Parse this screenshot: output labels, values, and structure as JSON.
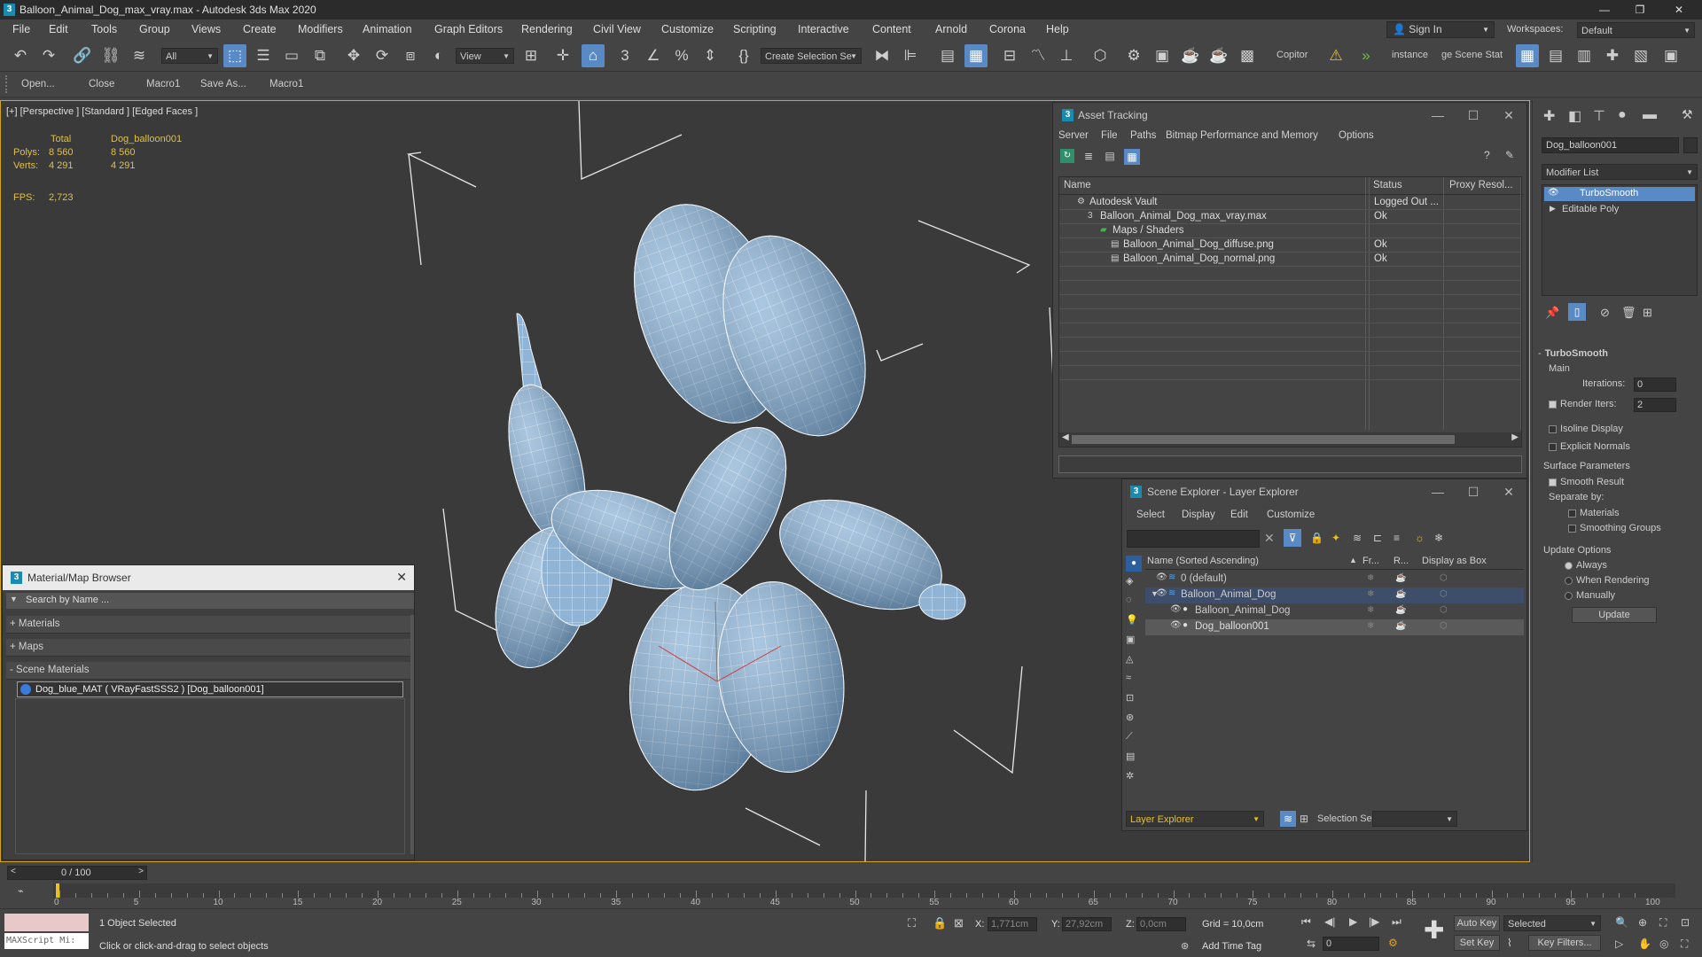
{
  "window": {
    "title": "Balloon_Animal_Dog_max_vray.max - Autodesk 3ds Max 2020"
  },
  "menu": [
    "File",
    "Edit",
    "Tools",
    "Group",
    "Views",
    "Create",
    "Modifiers",
    "Animation",
    "Graph Editors",
    "Rendering",
    "Civil View",
    "Customize",
    "Scripting",
    "Interactive",
    "Content",
    "Arnold",
    "Corona",
    "Help"
  ],
  "account": {
    "sign_in": "Sign In",
    "workspaces_label": "Workspaces:",
    "workspace": "Default"
  },
  "toolbar": {
    "selection_filter": "All",
    "ref_coord": "View",
    "named_selection": "Create Selection Se",
    "copitor": "Copitor",
    "instance": "instance",
    "scene_state": "ge Scene Stat"
  },
  "macros": [
    "Open...",
    "Close",
    "Macro1",
    "Save As...",
    "Macro1"
  ],
  "viewport": {
    "label": "[+] [Perspective ] [Standard ] [Edged Faces ]",
    "stats": {
      "total_label": "Total",
      "object_label": "Dog_balloon001",
      "polys_label": "Polys:",
      "polys_total": "8 560",
      "polys_obj": "8 560",
      "verts_label": "Verts:",
      "verts_total": "4 291",
      "verts_obj": "4 291",
      "fps_label": "FPS:",
      "fps_value": "2,723"
    }
  },
  "material_browser": {
    "title": "Material/Map Browser",
    "search_placeholder": "Search by Name ...",
    "sections": [
      "+ Materials",
      "+ Maps",
      "- Scene Materials"
    ],
    "scene_material": "Dog_blue_MAT ( VRayFastSSS2 ) [Dog_balloon001]"
  },
  "asset_tracking": {
    "title": "Asset Tracking",
    "menu": [
      "Server",
      "File",
      "Paths",
      "Bitmap Performance and Memory",
      "Options"
    ],
    "columns": [
      "Name",
      "Status",
      "Proxy Resol..."
    ],
    "rows": [
      {
        "name": "Autodesk Vault",
        "status": "Logged Out ..."
      },
      {
        "name": "Balloon_Animal_Dog_max_vray.max",
        "status": "Ok"
      },
      {
        "name": "Maps / Shaders",
        "status": ""
      },
      {
        "name": "Balloon_Animal_Dog_diffuse.png",
        "status": "Ok"
      },
      {
        "name": "Balloon_Animal_Dog_normal.png",
        "status": "Ok"
      }
    ]
  },
  "scene_explorer": {
    "title": "Scene Explorer - Layer Explorer",
    "menu": [
      "Select",
      "Display",
      "Edit",
      "Customize"
    ],
    "columns": [
      "Name (Sorted Ascending)",
      "Fr...",
      "R...",
      "Display as Box"
    ],
    "rows": [
      "0 (default)",
      "Balloon_Animal_Dog",
      "Balloon_Animal_Dog",
      "Dog_balloon001"
    ],
    "footer_label": "Layer Explorer",
    "selection_set_label": "Selection Set:"
  },
  "command_panel": {
    "object_name": "Dog_balloon001",
    "modifier_list": "Modifier List",
    "stack": [
      "TurboSmooth",
      "Editable Poly"
    ],
    "turbosmooth": {
      "title": "TurboSmooth",
      "main": "Main",
      "iterations_label": "Iterations:",
      "iterations": "0",
      "render_iters_label": "Render Iters:",
      "render_iters": "2",
      "isoline": "Isoline Display",
      "explicit_normals": "Explicit Normals",
      "surface_params": "Surface Parameters",
      "smooth_result": "Smooth Result",
      "separate_by": "Separate by:",
      "materials": "Materials",
      "smoothing_groups": "Smoothing Groups",
      "update_options": "Update Options",
      "always": "Always",
      "when_rendering": "When Rendering",
      "manually": "Manually",
      "update_button": "Update"
    }
  },
  "timeline": {
    "frame": "0 / 100",
    "ticks": [
      "0",
      "5",
      "10",
      "15",
      "20",
      "25",
      "30",
      "35",
      "40",
      "45",
      "50",
      "55",
      "60",
      "65",
      "70",
      "75",
      "80",
      "85",
      "90",
      "95",
      "100"
    ]
  },
  "status": {
    "maxscript": "MAXScript Mi:",
    "selected": "1 Object Selected",
    "prompt": "Click or click-and-drag to select objects",
    "x_label": "X:",
    "x": "1,771cm",
    "y_label": "Y:",
    "y": "27,92cm",
    "z_label": "Z:",
    "z": "0,0cm",
    "grid": "Grid = 10,0cm",
    "add_time_tag": "Add Time Tag",
    "auto_key": "Auto Key",
    "set_key": "Set Key",
    "selected_dd": "Selected",
    "key_filters": "Key Filters...",
    "frame_field": "0"
  }
}
